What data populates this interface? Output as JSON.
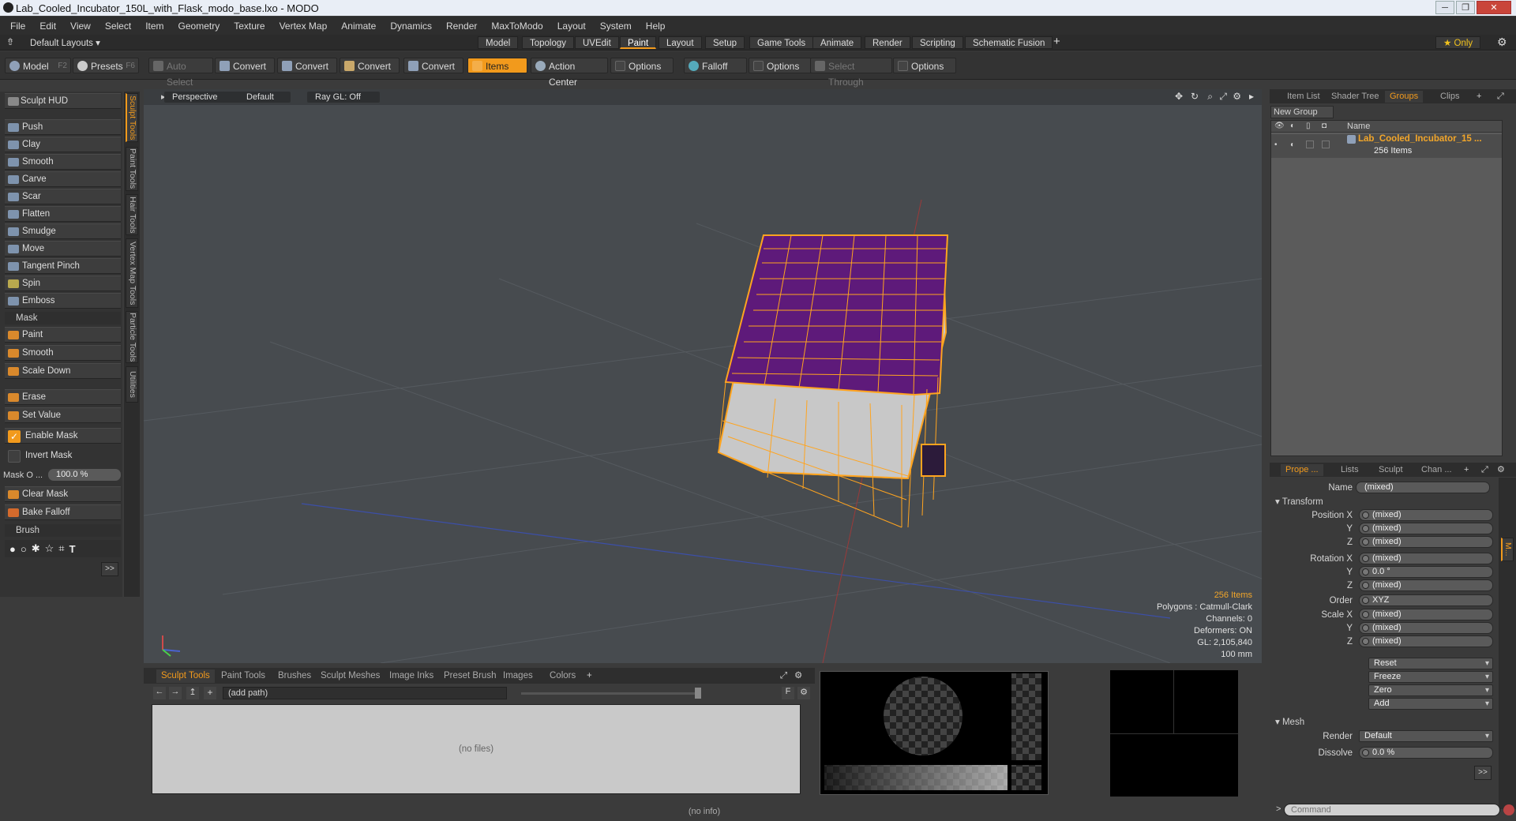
{
  "window": {
    "title": "Lab_Cooled_Incubator_150L_with_Flask_modo_base.lxo - MODO"
  },
  "menu": [
    "File",
    "Edit",
    "View",
    "Select",
    "Item",
    "Geometry",
    "Texture",
    "Vertex Map",
    "Animate",
    "Dynamics",
    "Render",
    "MaxToModo",
    "Layout",
    "System",
    "Help"
  ],
  "layoutbar": {
    "layouts_label": "Default Layouts ▾",
    "tabs": [
      "Model",
      "Topology",
      "UVEdit",
      "Paint",
      "Layout",
      "Setup",
      "Game Tools",
      "Animate",
      "Render",
      "Scripting",
      "Schematic Fusion"
    ],
    "active_tab": "Paint",
    "only_label": "★ Only"
  },
  "toolbar": {
    "model": "Model",
    "model_key": "F2",
    "presets": "Presets",
    "presets_key": "F6",
    "auto_select": "Auto Select",
    "convert": "Convert",
    "items": "Items",
    "action_center": "Action Center",
    "options": "Options",
    "falloff": "Falloff",
    "select_through": "Select Through"
  },
  "left_panel": {
    "hud": "Sculpt HUD",
    "tools": [
      "Push",
      "Clay",
      "Smooth",
      "Carve",
      "Scar",
      "Flatten",
      "Smudge",
      "Move",
      "Tangent Pinch",
      "Spin",
      "Emboss"
    ],
    "mask_header": "Mask",
    "mask_tools": [
      "Paint",
      "Smooth",
      "Scale Down"
    ],
    "erase": "Erase",
    "set_value": "Set Value",
    "enable_mask": "Enable Mask",
    "invert_mask": "Invert Mask",
    "mask_opacity_label": "Mask O ...",
    "mask_opacity_value": "100.0 %",
    "clear_mask": "Clear Mask",
    "bake_falloff": "Bake Falloff",
    "brush_header": "Brush",
    "more": ">>"
  },
  "vertical_tabs": [
    "Sculpt Tools",
    "Paint Tools",
    "Hair Tools",
    "Vertex Map Tools",
    "Particle Tools",
    "Utilities"
  ],
  "viewport": {
    "view": "Perspective",
    "shading": "Default",
    "raygl": "Ray GL: Off",
    "info": {
      "items": "256 Items",
      "polygons": "Polygons : Catmull-Clark",
      "channels": "Channels: 0",
      "deformers": "Deformers: ON",
      "gl": "GL: 2,105,840",
      "scale": "100 mm"
    }
  },
  "bottom": {
    "tabs": [
      "Sculpt Tools",
      "Paint Tools",
      "Brushes",
      "Sculpt Meshes",
      "Image Inks",
      "Preset Brush",
      "Images",
      "Colors"
    ],
    "active_tab": "Sculpt Tools",
    "path": "(add path)",
    "no_files": "(no files)",
    "status": "(no info)"
  },
  "right_top": {
    "tabs": [
      "Item List",
      "Shader Tree",
      "Groups",
      "Clips"
    ],
    "active_tab": "Groups",
    "new_group": "New Group",
    "name_header": "Name",
    "group_name": "Lab_Cooled_Incubator_15 ...",
    "group_count": "256 Items"
  },
  "properties": {
    "tabs": [
      "Prope ...",
      "Lists",
      "Sculpt",
      "Chan ..."
    ],
    "active_tab": "Prope ...",
    "name_label": "Name",
    "name_value": "(mixed)",
    "transform_header": "Transform",
    "position_x_label": "Position X",
    "y_label": "Y",
    "z_label": "Z",
    "position": [
      "(mixed)",
      "(mixed)",
      "(mixed)"
    ],
    "rotation_x_label": "Rotation X",
    "rotation": [
      "(mixed)",
      "0.0 °",
      "(mixed)"
    ],
    "order_label": "Order",
    "order_value": "XYZ",
    "scale_x_label": "Scale X",
    "scale": [
      "(mixed)",
      "(mixed)",
      "(mixed)"
    ],
    "actions": [
      "Reset",
      "Freeze",
      "Zero",
      "Add"
    ],
    "mesh_header": "Mesh",
    "render_label": "Render",
    "render_value": "Default",
    "dissolve_label": "Dissolve",
    "dissolve_value": "0.0 %",
    "more": ">>"
  },
  "command": {
    "placeholder": "Command",
    "prompt": ">"
  },
  "colors": {
    "accent": "#f29a1c",
    "wire": "#ffa41f",
    "top_face": "#5e1a7a",
    "body_face": "#c8c8c8"
  }
}
